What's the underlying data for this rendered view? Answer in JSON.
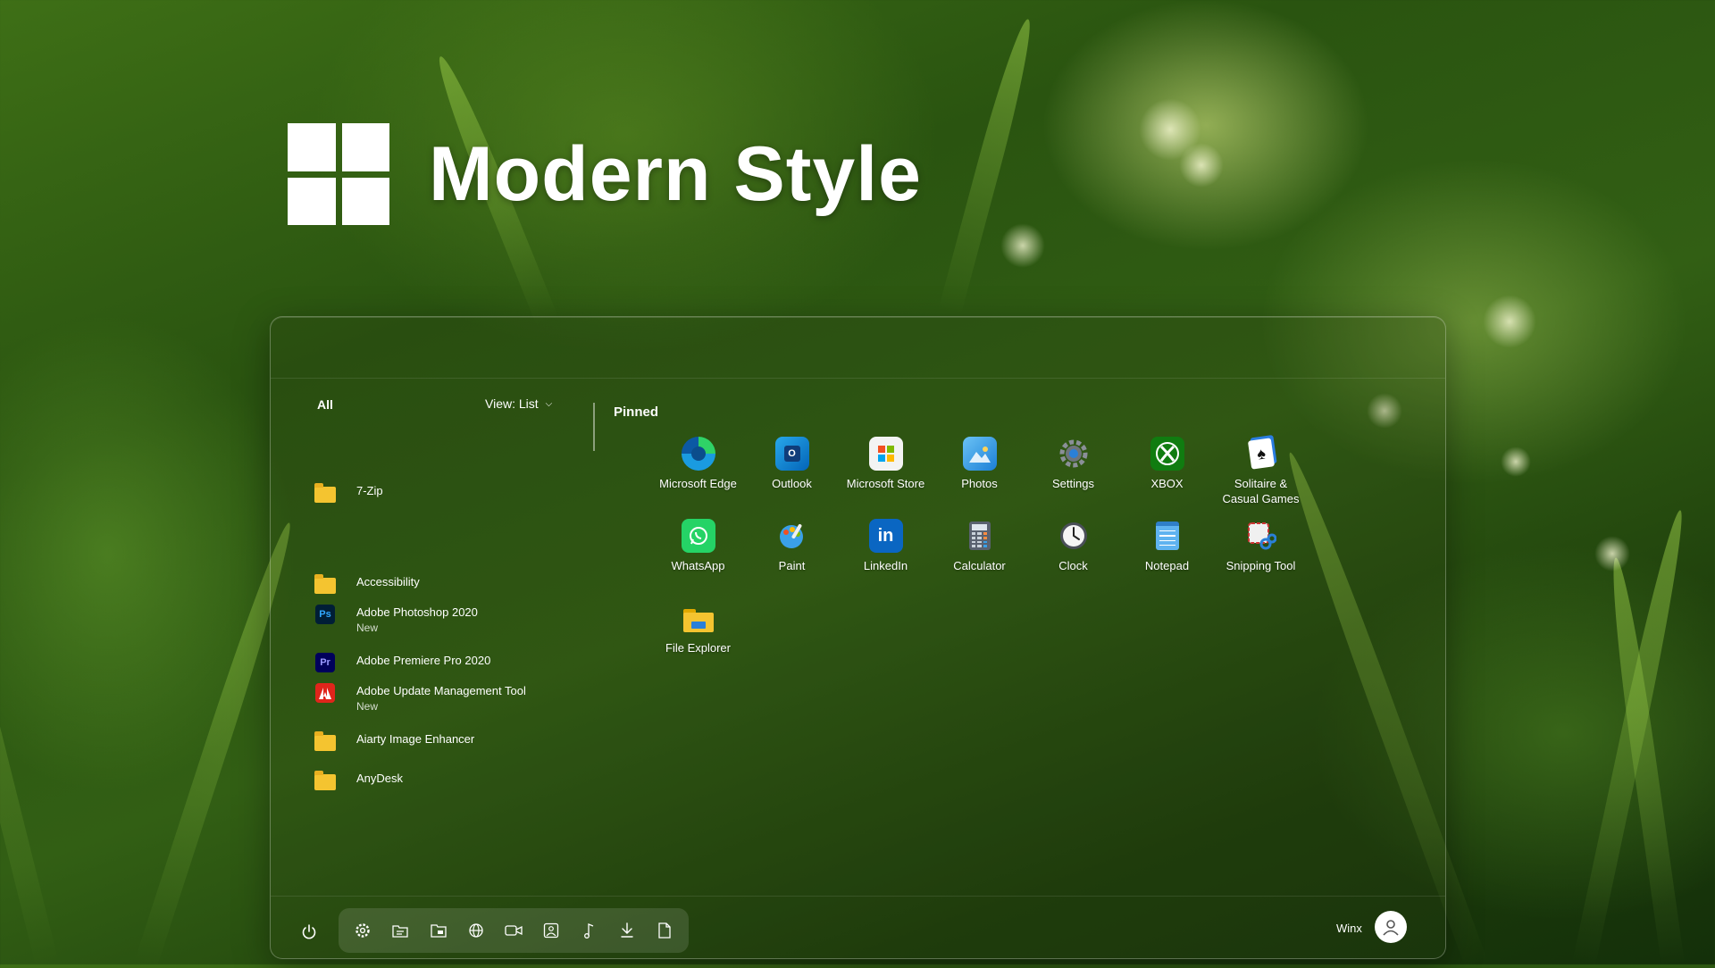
{
  "hero": {
    "title": "Modern Style"
  },
  "start_menu": {
    "all_label": "All",
    "view_label": "View: List",
    "pinned_label": "Pinned",
    "apps": [
      {
        "name": "7-Zip",
        "sub": "",
        "icon": "folder-icon"
      },
      {
        "name": "Accessibility",
        "sub": "",
        "icon": "folder-icon"
      },
      {
        "name": "Adobe Photoshop 2020",
        "sub": "New",
        "icon": "photoshop-icon",
        "badge": "Ps"
      },
      {
        "name": "Adobe Premiere Pro 2020",
        "sub": "",
        "icon": "premiere-icon",
        "badge": "Pr"
      },
      {
        "name": "Adobe Update Management Tool",
        "sub": "New",
        "icon": "adobe-icon"
      },
      {
        "name": "Aiarty Image Enhancer",
        "sub": "",
        "icon": "folder-icon"
      },
      {
        "name": "AnyDesk",
        "sub": "",
        "icon": "folder-icon"
      }
    ],
    "pinned": [
      {
        "label": "Microsoft Edge",
        "icon": "edge-icon"
      },
      {
        "label": "Outlook",
        "icon": "outlook-icon",
        "glyph": "O"
      },
      {
        "label": "Microsoft Store",
        "icon": "store-icon"
      },
      {
        "label": "Photos",
        "icon": "photos-icon"
      },
      {
        "label": "Settings",
        "icon": "settings-icon"
      },
      {
        "label": "XBOX",
        "icon": "xbox-icon"
      },
      {
        "label": "Solitaire &\nCasual Games",
        "icon": "solitaire-icon"
      },
      {
        "label": "WhatsApp",
        "icon": "whatsapp-icon"
      },
      {
        "label": "Paint",
        "icon": "paint-icon"
      },
      {
        "label": "LinkedIn",
        "icon": "linkedin-icon",
        "glyph": "in"
      },
      {
        "label": "Calculator",
        "icon": "calculator-icon"
      },
      {
        "label": "Clock",
        "icon": "clock-icon"
      },
      {
        "label": "Notepad",
        "icon": "notepad-icon"
      },
      {
        "label": "Snipping Tool",
        "icon": "snipping-tool-icon"
      },
      {
        "label": "File Explorer",
        "icon": "file-explorer-icon"
      }
    ],
    "toolbar": [
      "settings-icon",
      "documents-folder-icon",
      "file-explorer-icon",
      "network-icon",
      "videos-icon",
      "pictures-icon",
      "music-icon",
      "downloads-icon",
      "file-icon"
    ],
    "user": {
      "name": "Winx"
    }
  },
  "colors": {
    "folder": "#f4c430",
    "photoshop": "#001e36",
    "premiere": "#00005b",
    "adobe_red": "#e0251b",
    "edge": "#1a9be0",
    "xbox": "#107c10",
    "whatsapp": "#25d366",
    "linkedin": "#0a66c2"
  }
}
